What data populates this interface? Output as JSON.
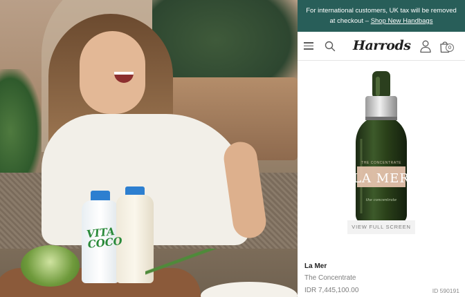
{
  "banner": {
    "line1": "For international customers, UK tax will be removed",
    "line2": "at checkout",
    "separator": "– ",
    "link_label": "Shop New Handbags",
    "background_color": "#285e59"
  },
  "header": {
    "menu_icon": "hamburger-menu-icon",
    "search_icon": "search-icon",
    "logo_text": "Harrods",
    "account_icon": "user-icon",
    "bag_icon": "shopping-bag-icon",
    "bag_count": "0"
  },
  "product": {
    "image_label_brand": "LA MER",
    "image_label_name_top": "THE CONCENTRATE",
    "image_label_name_bottom": "the concentrate",
    "view_full_screen": "View Full Screen",
    "brand": "La Mer",
    "name": "The Concentrate",
    "price": "IDR 7,445,100.00",
    "id": "ID 590191"
  },
  "photo": {
    "bottle_brand": "VITA COCO"
  }
}
